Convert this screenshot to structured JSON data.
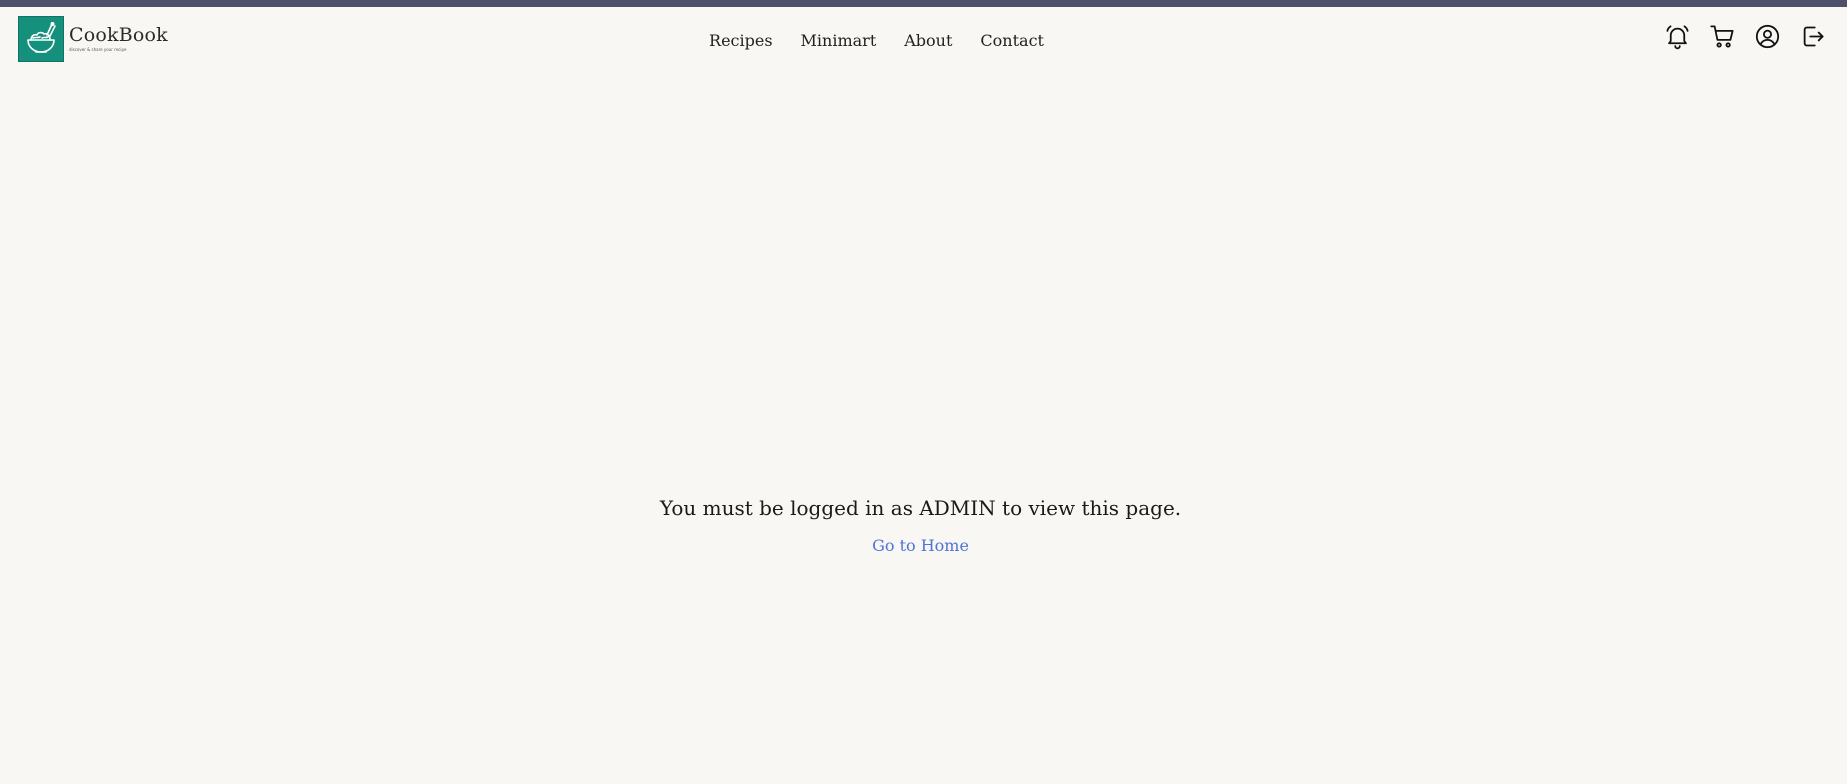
{
  "brand": {
    "name": "CookBook",
    "tagline": "discover & share your recipe"
  },
  "nav": {
    "items": [
      {
        "label": "Recipes"
      },
      {
        "label": "Minimart"
      },
      {
        "label": "About"
      },
      {
        "label": "Contact"
      }
    ]
  },
  "header_icons": [
    "bell-icon",
    "cart-icon",
    "user-icon",
    "logout-icon"
  ],
  "colors": {
    "topbar": "#4d5068",
    "brand": "#14907c",
    "background": "#f8f7f3",
    "link": "#4f73d8"
  },
  "main": {
    "message": "You must be logged in as ADMIN to view this page.",
    "home_link": "Go to Home"
  }
}
